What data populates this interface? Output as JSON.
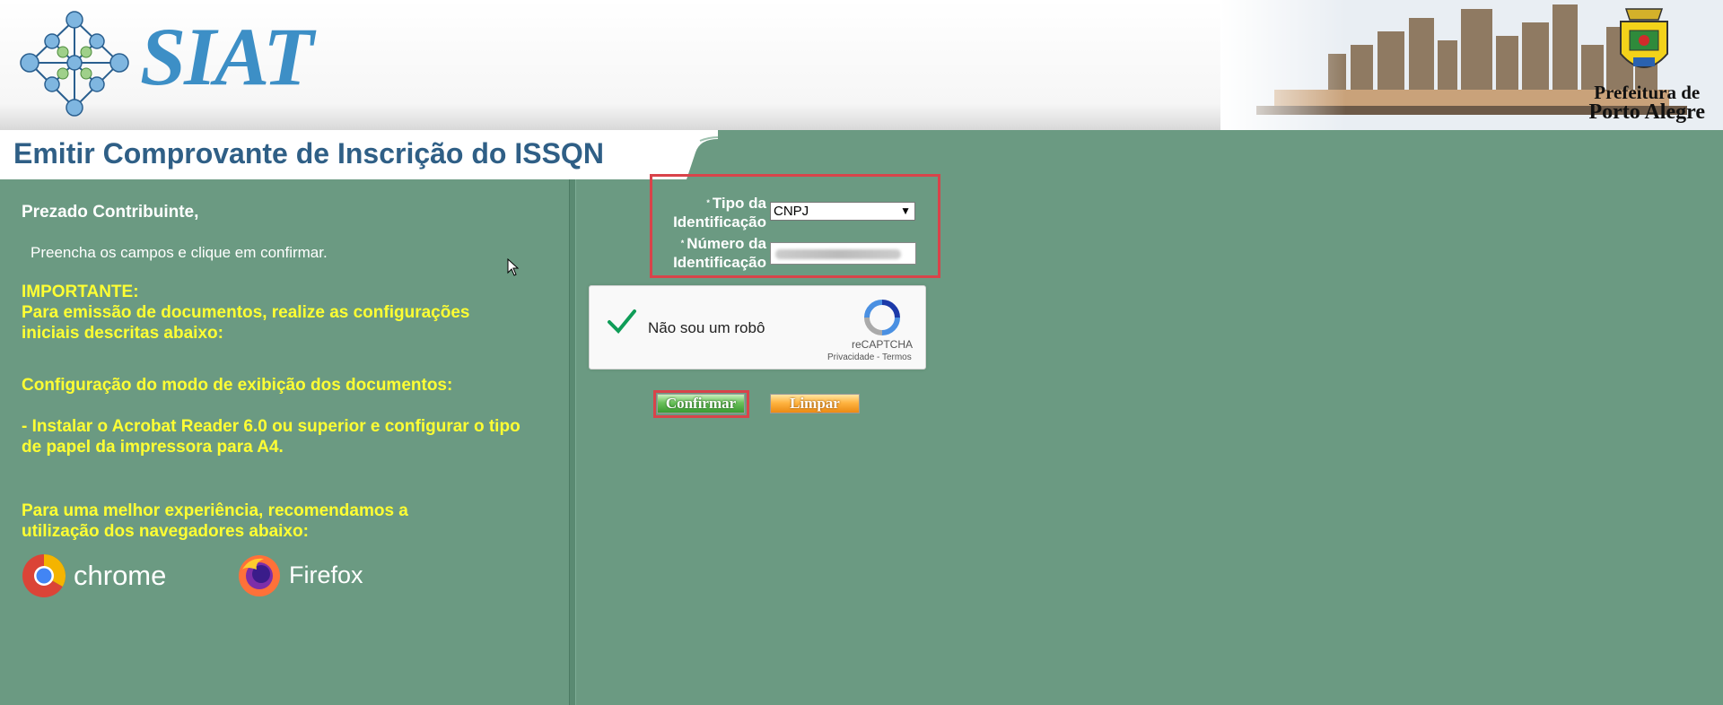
{
  "header": {
    "logo_text": "SIAT",
    "prefeitura_line1": "Prefeitura de",
    "prefeitura_line2": "Porto Alegre"
  },
  "page_title": "Emitir Comprovante de Inscrição do ISSQN",
  "left_panel": {
    "greeting": "Prezado Contribuinte,",
    "hint": "Preencha os campos e clique em confirmar.",
    "important_title": "IMPORTANTE:",
    "important_text": "Para emissão de documentos, realize as configurações iniciais descritas abaixo:",
    "config_title": "Configuração do modo de exibição dos documentos:",
    "config_text": "- Instalar o Acrobat Reader 6.0 ou superior e configurar o tipo de papel da impressora para A4.",
    "browsers_text": "Para uma melhor experiência, recomendamos a utilização dos navegadores abaixo:",
    "browsers": [
      "chrome",
      "Firefox"
    ]
  },
  "form": {
    "tipo_label_1": "Tipo da",
    "tipo_label_2": "Identificação",
    "numero_label_1": "Número da",
    "numero_label_2": "Identificação",
    "tipo_value": "CNPJ",
    "required_mark": "*"
  },
  "captcha": {
    "text": "Não sou um robô",
    "brand": "reCAPTCHA",
    "links": "Privacidade - Termos"
  },
  "buttons": {
    "confirm": "Confirmar",
    "clear": "Limpar"
  },
  "colors": {
    "background": "#6b9a82",
    "title": "#2f5f86",
    "highlight_text": "#ffff33",
    "annotation_box": "#d9434a"
  }
}
